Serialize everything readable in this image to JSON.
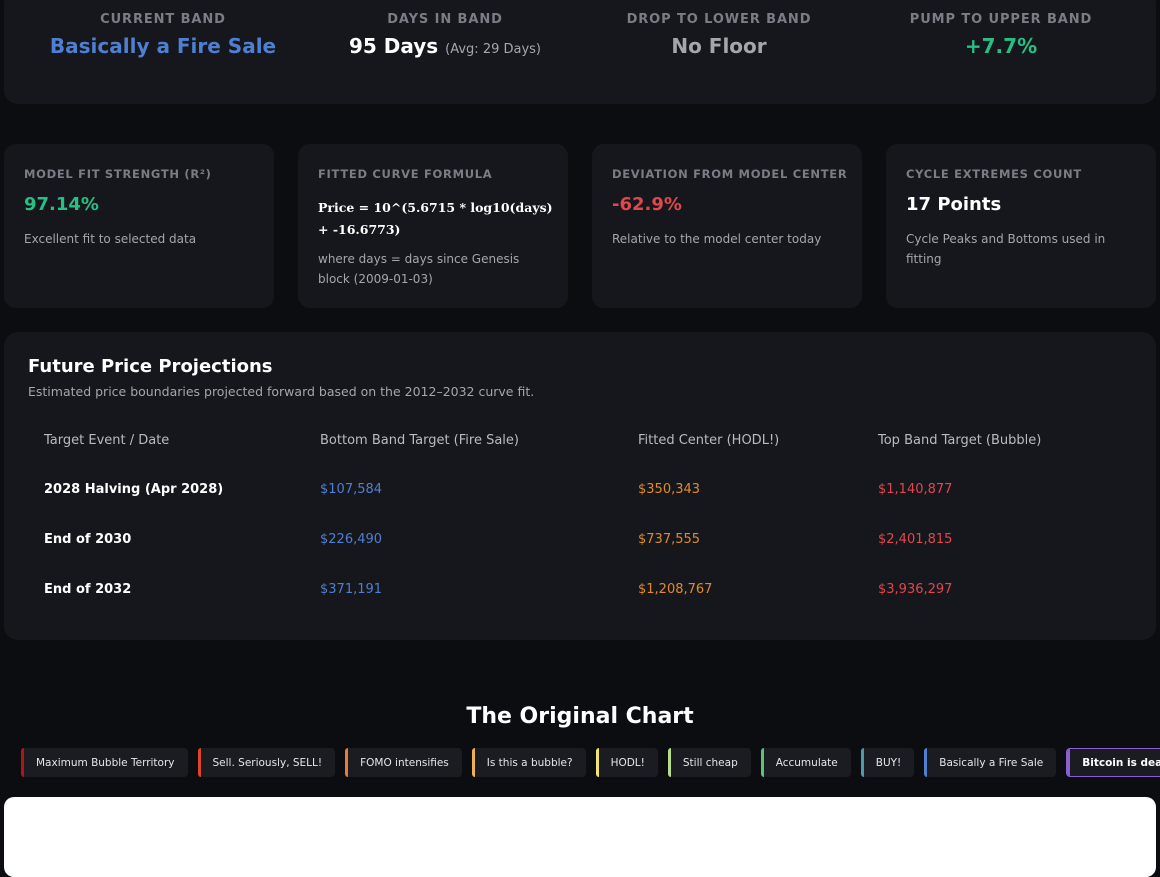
{
  "status": {
    "current_band": {
      "label": "CURRENT BAND",
      "value": "Basically a Fire Sale",
      "color": "#4f7fd0"
    },
    "days_in_band": {
      "label": "DAYS IN BAND",
      "value": "95 Days",
      "avg": "(Avg: 29 Days)"
    },
    "drop_lower": {
      "label": "DROP TO LOWER BAND",
      "value": "No Floor",
      "color": "#a4a6ae"
    },
    "pump_upper": {
      "label": "PUMP TO UPPER BAND",
      "value": "+7.7%",
      "color": "#27c082"
    }
  },
  "metrics": {
    "fit": {
      "label": "MODEL FIT STRENGTH (R²)",
      "value": "97.14%",
      "desc": "Excellent fit to selected data",
      "color": "#27c082"
    },
    "formula": {
      "label": "FITTED CURVE FORMULA",
      "value": "Price = 10^(5.6715 * log10(days) + -16.6773)",
      "desc": "where days = days since Genesis block (2009-01-03)"
    },
    "deviation": {
      "label": "DEVIATION FROM MODEL CENTER",
      "value": "-62.9%",
      "desc": "Relative to the model center today",
      "color": "#e0474c"
    },
    "extremes": {
      "label": "CYCLE EXTREMES COUNT",
      "value": "17 Points",
      "desc": "Cycle Peaks and Bottoms used in fitting"
    }
  },
  "projections": {
    "title": "Future Price Projections",
    "subtitle": "Estimated price boundaries projected forward based on the 2012–2032 curve fit.",
    "headers": [
      "Target Event / Date",
      "Bottom Band Target (Fire Sale)",
      "Fitted Center (HODL!)",
      "Top Band Target (Bubble)"
    ],
    "rows": [
      {
        "event": "2028 Halving (Apr 2028)",
        "bottom": "$107,584",
        "center": "$350,343",
        "top": "$1,140,877"
      },
      {
        "event": "End of 2030",
        "bottom": "$226,490",
        "center": "$737,555",
        "top": "$2,401,815"
      },
      {
        "event": "End of 2032",
        "bottom": "$371,191",
        "center": "$1,208,767",
        "top": "$3,936,297"
      }
    ]
  },
  "original_chart": {
    "title": "The Original Chart",
    "legend": [
      {
        "label": "Maximum Bubble Territory",
        "color": "#b0151b"
      },
      {
        "label": "Sell. Seriously, SELL!",
        "color": "#e0452c"
      },
      {
        "label": "FOMO intensifies",
        "color": "#e87a3a"
      },
      {
        "label": "Is this a bubble?",
        "color": "#f0b050"
      },
      {
        "label": "HODL!",
        "color": "#f2e27a"
      },
      {
        "label": "Still cheap",
        "color": "#b7dc8a"
      },
      {
        "label": "Accumulate",
        "color": "#5fc07a"
      },
      {
        "label": "BUY!",
        "color": "#4f9aa8"
      },
      {
        "label": "Basically a Fire Sale",
        "color": "#4f7fd0"
      },
      {
        "label": "Bitcoin is dead",
        "color": "#8a5fd0",
        "active": true
      }
    ]
  }
}
